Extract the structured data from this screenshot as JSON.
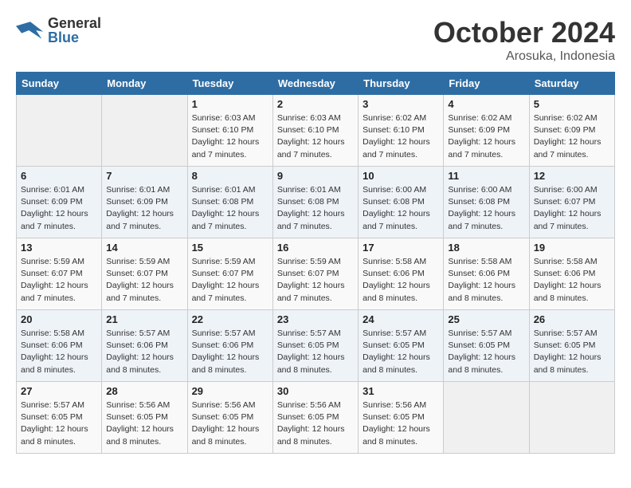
{
  "header": {
    "logo_line1": "General",
    "logo_line2": "Blue",
    "month": "October 2024",
    "location": "Arosuka, Indonesia"
  },
  "weekdays": [
    "Sunday",
    "Monday",
    "Tuesday",
    "Wednesday",
    "Thursday",
    "Friday",
    "Saturday"
  ],
  "weeks": [
    [
      {
        "day": "",
        "info": ""
      },
      {
        "day": "",
        "info": ""
      },
      {
        "day": "1",
        "info": "Sunrise: 6:03 AM\nSunset: 6:10 PM\nDaylight: 12 hours\nand 7 minutes."
      },
      {
        "day": "2",
        "info": "Sunrise: 6:03 AM\nSunset: 6:10 PM\nDaylight: 12 hours\nand 7 minutes."
      },
      {
        "day": "3",
        "info": "Sunrise: 6:02 AM\nSunset: 6:10 PM\nDaylight: 12 hours\nand 7 minutes."
      },
      {
        "day": "4",
        "info": "Sunrise: 6:02 AM\nSunset: 6:09 PM\nDaylight: 12 hours\nand 7 minutes."
      },
      {
        "day": "5",
        "info": "Sunrise: 6:02 AM\nSunset: 6:09 PM\nDaylight: 12 hours\nand 7 minutes."
      }
    ],
    [
      {
        "day": "6",
        "info": "Sunrise: 6:01 AM\nSunset: 6:09 PM\nDaylight: 12 hours\nand 7 minutes."
      },
      {
        "day": "7",
        "info": "Sunrise: 6:01 AM\nSunset: 6:09 PM\nDaylight: 12 hours\nand 7 minutes."
      },
      {
        "day": "8",
        "info": "Sunrise: 6:01 AM\nSunset: 6:08 PM\nDaylight: 12 hours\nand 7 minutes."
      },
      {
        "day": "9",
        "info": "Sunrise: 6:01 AM\nSunset: 6:08 PM\nDaylight: 12 hours\nand 7 minutes."
      },
      {
        "day": "10",
        "info": "Sunrise: 6:00 AM\nSunset: 6:08 PM\nDaylight: 12 hours\nand 7 minutes."
      },
      {
        "day": "11",
        "info": "Sunrise: 6:00 AM\nSunset: 6:08 PM\nDaylight: 12 hours\nand 7 minutes."
      },
      {
        "day": "12",
        "info": "Sunrise: 6:00 AM\nSunset: 6:07 PM\nDaylight: 12 hours\nand 7 minutes."
      }
    ],
    [
      {
        "day": "13",
        "info": "Sunrise: 5:59 AM\nSunset: 6:07 PM\nDaylight: 12 hours\nand 7 minutes."
      },
      {
        "day": "14",
        "info": "Sunrise: 5:59 AM\nSunset: 6:07 PM\nDaylight: 12 hours\nand 7 minutes."
      },
      {
        "day": "15",
        "info": "Sunrise: 5:59 AM\nSunset: 6:07 PM\nDaylight: 12 hours\nand 7 minutes."
      },
      {
        "day": "16",
        "info": "Sunrise: 5:59 AM\nSunset: 6:07 PM\nDaylight: 12 hours\nand 7 minutes."
      },
      {
        "day": "17",
        "info": "Sunrise: 5:58 AM\nSunset: 6:06 PM\nDaylight: 12 hours\nand 8 minutes."
      },
      {
        "day": "18",
        "info": "Sunrise: 5:58 AM\nSunset: 6:06 PM\nDaylight: 12 hours\nand 8 minutes."
      },
      {
        "day": "19",
        "info": "Sunrise: 5:58 AM\nSunset: 6:06 PM\nDaylight: 12 hours\nand 8 minutes."
      }
    ],
    [
      {
        "day": "20",
        "info": "Sunrise: 5:58 AM\nSunset: 6:06 PM\nDaylight: 12 hours\nand 8 minutes."
      },
      {
        "day": "21",
        "info": "Sunrise: 5:57 AM\nSunset: 6:06 PM\nDaylight: 12 hours\nand 8 minutes."
      },
      {
        "day": "22",
        "info": "Sunrise: 5:57 AM\nSunset: 6:06 PM\nDaylight: 12 hours\nand 8 minutes."
      },
      {
        "day": "23",
        "info": "Sunrise: 5:57 AM\nSunset: 6:05 PM\nDaylight: 12 hours\nand 8 minutes."
      },
      {
        "day": "24",
        "info": "Sunrise: 5:57 AM\nSunset: 6:05 PM\nDaylight: 12 hours\nand 8 minutes."
      },
      {
        "day": "25",
        "info": "Sunrise: 5:57 AM\nSunset: 6:05 PM\nDaylight: 12 hours\nand 8 minutes."
      },
      {
        "day": "26",
        "info": "Sunrise: 5:57 AM\nSunset: 6:05 PM\nDaylight: 12 hours\nand 8 minutes."
      }
    ],
    [
      {
        "day": "27",
        "info": "Sunrise: 5:57 AM\nSunset: 6:05 PM\nDaylight: 12 hours\nand 8 minutes."
      },
      {
        "day": "28",
        "info": "Sunrise: 5:56 AM\nSunset: 6:05 PM\nDaylight: 12 hours\nand 8 minutes."
      },
      {
        "day": "29",
        "info": "Sunrise: 5:56 AM\nSunset: 6:05 PM\nDaylight: 12 hours\nand 8 minutes."
      },
      {
        "day": "30",
        "info": "Sunrise: 5:56 AM\nSunset: 6:05 PM\nDaylight: 12 hours\nand 8 minutes."
      },
      {
        "day": "31",
        "info": "Sunrise: 5:56 AM\nSunset: 6:05 PM\nDaylight: 12 hours\nand 8 minutes."
      },
      {
        "day": "",
        "info": ""
      },
      {
        "day": "",
        "info": ""
      }
    ]
  ]
}
